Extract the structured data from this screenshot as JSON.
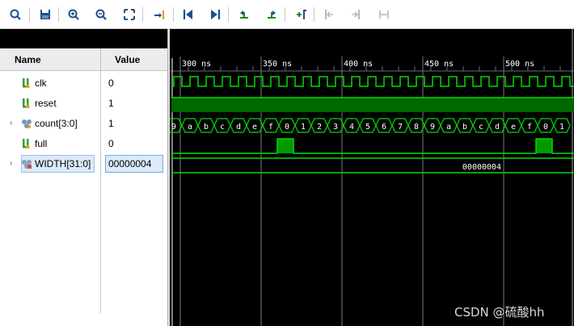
{
  "columns": {
    "name": "Name",
    "value": "Value"
  },
  "signals": [
    {
      "name": "clk",
      "value": "0",
      "icon": "logic-signal-icon"
    },
    {
      "name": "reset",
      "value": "1",
      "icon": "logic-signal-icon"
    },
    {
      "name": "count[3:0]",
      "value": "1",
      "icon": "bus-signal-icon",
      "expandable": true
    },
    {
      "name": "full",
      "value": "0",
      "icon": "logic-signal-icon"
    },
    {
      "name": "WIDTH[31:0]",
      "value": "00000004",
      "icon": "parameter-bus-icon",
      "expandable": true,
      "selected": true
    }
  ],
  "timeline": {
    "unit": "ns",
    "labels": [
      "300 ns",
      "350 ns",
      "400 ns",
      "450 ns",
      "500 ns"
    ],
    "tick_values": [
      300,
      350,
      400,
      450,
      500
    ]
  },
  "count_values": [
    "9",
    "a",
    "b",
    "c",
    "d",
    "e",
    "f",
    "0",
    "1",
    "2",
    "3",
    "4",
    "5",
    "6",
    "7",
    "8",
    "9",
    "a",
    "b",
    "c",
    "d",
    "e",
    "f",
    "0",
    "1"
  ],
  "width_value_label": "00000004",
  "colors": {
    "wave": "#00dd00",
    "bus": "#00dd00",
    "cursor": "#ffffff",
    "background": "#000000",
    "ruler_text": "#ffffff"
  },
  "toolbar_icons": [
    "search-icon",
    "save-icon",
    "zoom-in-icon",
    "zoom-out-icon",
    "zoom-fit-icon",
    "go-to-cursor-icon",
    "go-to-start-icon",
    "go-to-end-icon",
    "previous-transition-icon",
    "next-transition-icon",
    "add-marker-icon",
    "previous-marker-icon",
    "next-marker-icon",
    "swap-cursors-icon"
  ],
  "watermark": "CSDN @硫酸hh"
}
